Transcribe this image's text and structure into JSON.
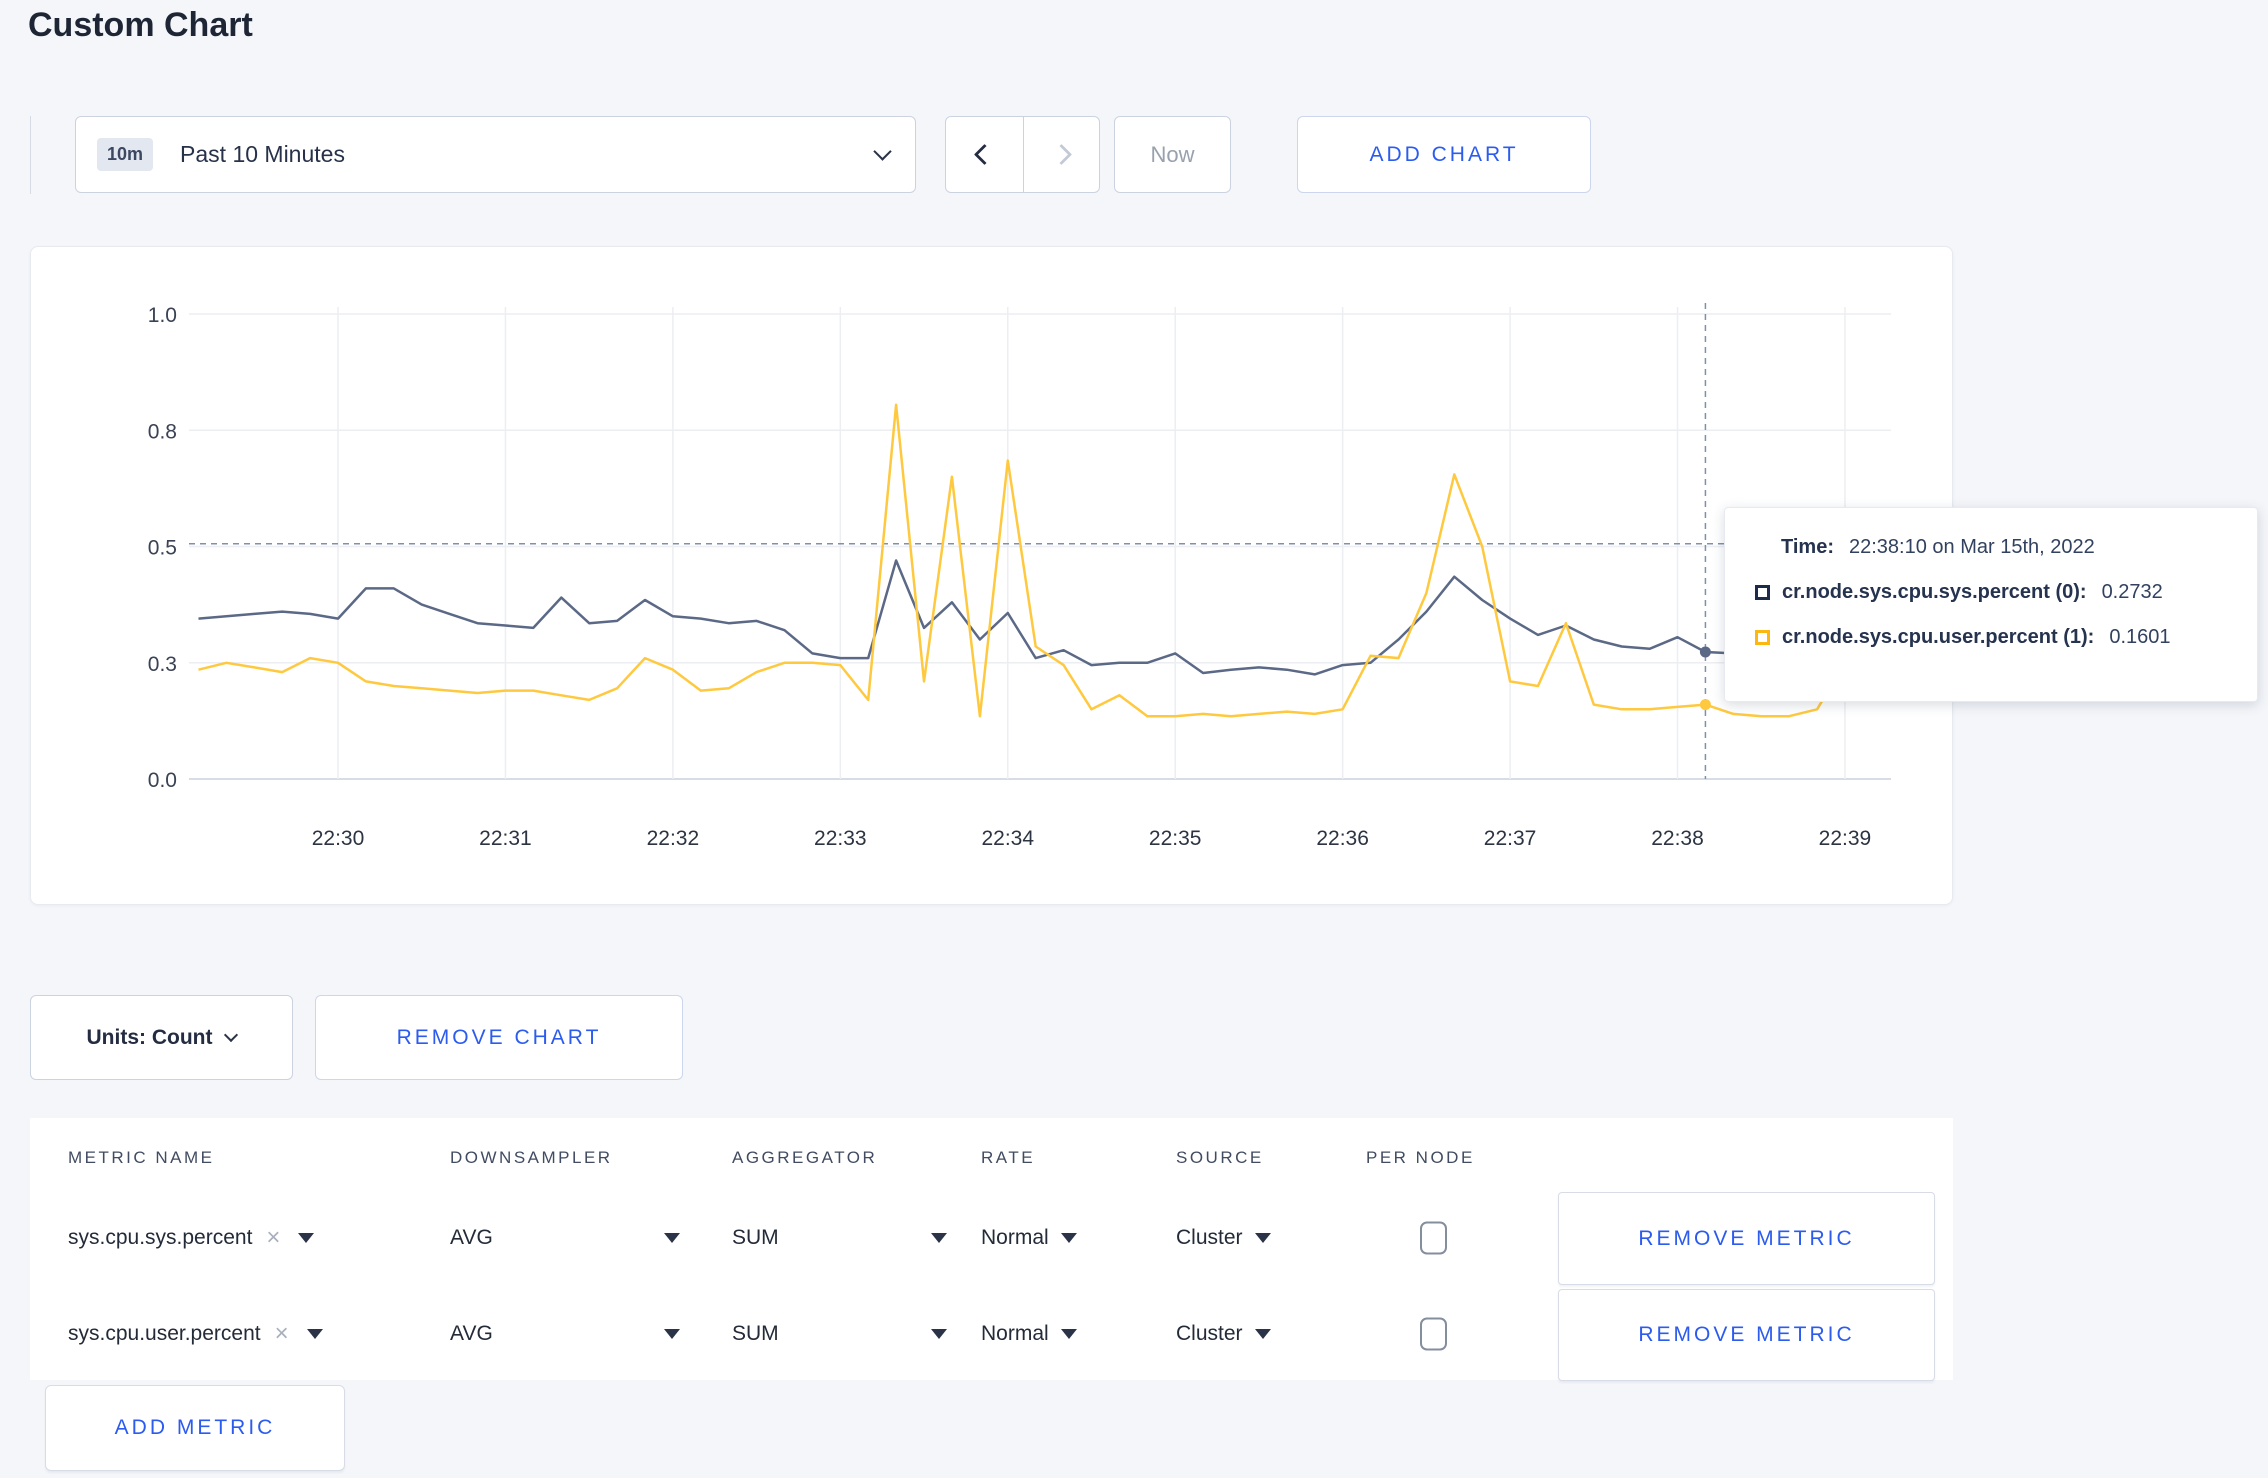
{
  "page": {
    "title": "Custom Chart"
  },
  "colors": {
    "accent_blue": "#2b5bef",
    "series_sys": "#5b6987",
    "series_user": "#ffc93f",
    "swatch_sys": "#1c2b49",
    "swatch_user": "#fdb713",
    "grid": "#eceef2",
    "axis_line": "#d8dce4",
    "axis_text": "#3a4254",
    "crosshair": "#7f91a9"
  },
  "toolbar": {
    "time_badge": "10m",
    "time_label": "Past 10 Minutes",
    "now_label": "Now",
    "add_chart_label": "ADD CHART"
  },
  "chart_data": {
    "type": "line",
    "title": "",
    "xlabel": "",
    "ylabel": "",
    "ylim": [
      0,
      1
    ],
    "grid": true,
    "legend_position": "tooltip-overlay",
    "y_ticks": [
      {
        "label": "0.0",
        "value": 0
      },
      {
        "label": "0.3",
        "value": 0.25
      },
      {
        "label": "0.5",
        "value": 0.5
      },
      {
        "label": "0.8",
        "value": 0.75
      },
      {
        "label": "1.0",
        "value": 1
      }
    ],
    "x_ticks": [
      "22:30",
      "22:31",
      "22:32",
      "22:33",
      "22:34",
      "22:35",
      "22:36",
      "22:37",
      "22:38",
      "22:39"
    ],
    "times": [
      "22:29:10",
      "22:29:20",
      "22:29:30",
      "22:29:40",
      "22:29:50",
      "22:30:00",
      "22:30:10",
      "22:30:20",
      "22:30:30",
      "22:30:40",
      "22:30:50",
      "22:31:00",
      "22:31:10",
      "22:31:20",
      "22:31:30",
      "22:31:40",
      "22:31:50",
      "22:32:00",
      "22:32:10",
      "22:32:20",
      "22:32:30",
      "22:32:40",
      "22:32:50",
      "22:33:00",
      "22:33:10",
      "22:33:20",
      "22:33:30",
      "22:33:40",
      "22:33:50",
      "22:34:00",
      "22:34:10",
      "22:34:20",
      "22:34:30",
      "22:34:40",
      "22:34:50",
      "22:35:00",
      "22:35:10",
      "22:35:20",
      "22:35:30",
      "22:35:40",
      "22:35:50",
      "22:36:00",
      "22:36:10",
      "22:36:20",
      "22:36:30",
      "22:36:40",
      "22:36:50",
      "22:37:00",
      "22:37:10",
      "22:37:20",
      "22:37:30",
      "22:37:40",
      "22:37:50",
      "22:38:00",
      "22:38:10",
      "22:38:20",
      "22:38:30",
      "22:38:40",
      "22:38:50",
      "22:39:00",
      "22:39:10",
      "22:39:20"
    ],
    "series": [
      {
        "name": "cr.node.sys.cpu.sys.percent",
        "color_key": "series_sys",
        "values": [
          0.345,
          0.35,
          0.355,
          0.36,
          0.355,
          0.345,
          0.41,
          0.41,
          0.375,
          0.355,
          0.335,
          0.33,
          0.325,
          0.39,
          0.335,
          0.34,
          0.385,
          0.35,
          0.345,
          0.335,
          0.34,
          0.32,
          0.27,
          0.26,
          0.26,
          0.47,
          0.325,
          0.38,
          0.3,
          0.357,
          0.26,
          0.277,
          0.245,
          0.25,
          0.25,
          0.27,
          0.228,
          0.235,
          0.24,
          0.235,
          0.225,
          0.245,
          0.25,
          0.3,
          0.36,
          0.435,
          0.385,
          0.345,
          0.31,
          0.33,
          0.3,
          0.285,
          0.28,
          0.305,
          0.2732,
          0.27,
          0.26,
          0.265,
          0.27,
          0.285,
          0.3,
          0.305
        ]
      },
      {
        "name": "cr.node.sys.cpu.user.percent",
        "color_key": "series_user",
        "values": [
          0.235,
          0.25,
          0.24,
          0.23,
          0.26,
          0.25,
          0.21,
          0.2,
          0.195,
          0.19,
          0.185,
          0.19,
          0.19,
          0.18,
          0.17,
          0.195,
          0.26,
          0.235,
          0.19,
          0.195,
          0.23,
          0.25,
          0.25,
          0.245,
          0.17,
          0.805,
          0.21,
          0.65,
          0.135,
          0.685,
          0.285,
          0.245,
          0.15,
          0.18,
          0.135,
          0.135,
          0.14,
          0.135,
          0.14,
          0.145,
          0.14,
          0.15,
          0.265,
          0.26,
          0.4,
          0.655,
          0.5,
          0.21,
          0.2,
          0.335,
          0.16,
          0.15,
          0.15,
          0.155,
          0.1601,
          0.14,
          0.135,
          0.135,
          0.15,
          0.25,
          0.27,
          0.245
        ]
      }
    ],
    "crosshair": {
      "time": "22:38:10",
      "x_index": 54,
      "y_value": 0.506
    }
  },
  "tooltip": {
    "time_label": "Time:",
    "time_value": "22:38:10 on Mar 15th, 2022",
    "rows": [
      {
        "label": "cr.node.sys.cpu.sys.percent (0):",
        "value": "0.2732"
      },
      {
        "label": "cr.node.sys.cpu.user.percent (1):",
        "value": "0.1601"
      }
    ]
  },
  "units_bar": {
    "units_label": "Units: Count",
    "remove_chart_label": "REMOVE CHART"
  },
  "metrics_table": {
    "headers": [
      "METRIC NAME",
      "DOWNSAMPLER",
      "AGGREGATOR",
      "RATE",
      "SOURCE",
      "PER NODE"
    ],
    "rows": [
      {
        "metric": "sys.cpu.sys.percent",
        "downsampler": "AVG",
        "aggregator": "SUM",
        "rate": "Normal",
        "source": "Cluster",
        "per_node_checked": false,
        "remove_label": "REMOVE METRIC"
      },
      {
        "metric": "sys.cpu.user.percent",
        "downsampler": "AVG",
        "aggregator": "SUM",
        "rate": "Normal",
        "source": "Cluster",
        "per_node_checked": false,
        "remove_label": "REMOVE METRIC"
      }
    ],
    "add_metric_label": "ADD METRIC"
  },
  "icons": {
    "chevron-down": "css-rotated-border-chevron",
    "chevron-left": "css-rotated-border-chevron",
    "chevron-right": "css-rotated-border-chevron",
    "caret-down": "css-border-triangle",
    "close": "×",
    "checkbox-unchecked": "css-rounded-rect"
  }
}
